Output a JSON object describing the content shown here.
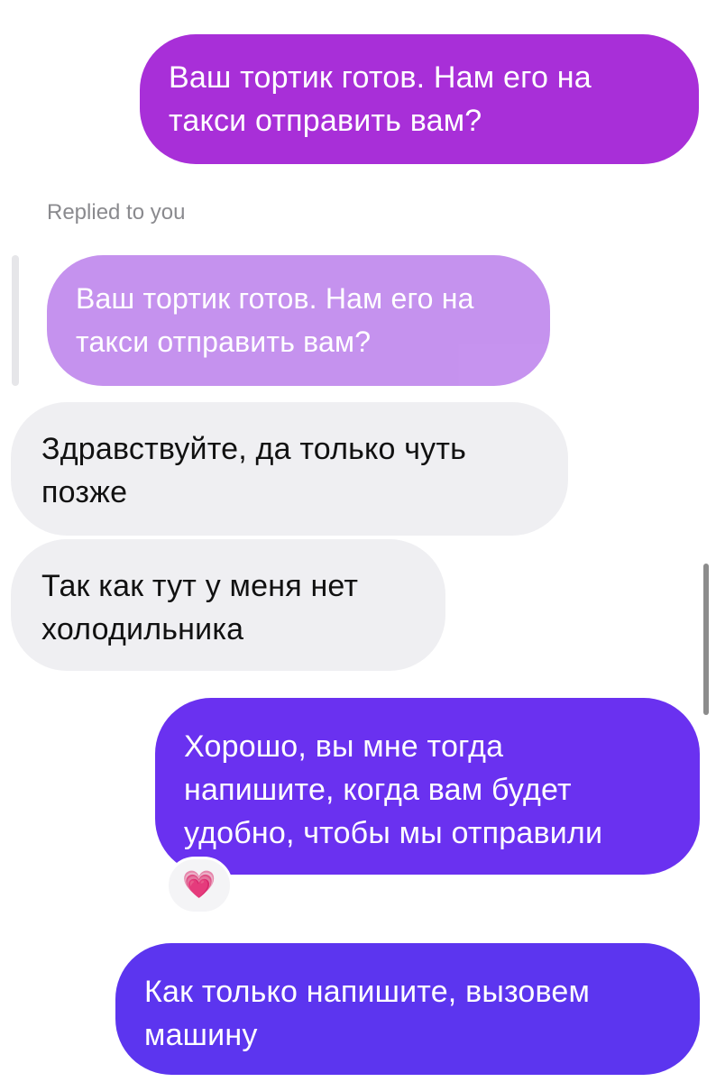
{
  "chat": {
    "messages": [
      {
        "sender": "me",
        "text": "Ваш тортик готов. Нам его на\nтакси отправить вам?"
      },
      {
        "sender": "them",
        "text": "Здравствуйте, да только чуть\nпозже"
      },
      {
        "sender": "them",
        "text": "Так как тут у меня нет\nхолодильника"
      },
      {
        "sender": "me",
        "text": "Хорошо, вы мне тогда\nнапишите, когда вам будет\nудобно, чтобы мы отправили"
      },
      {
        "sender": "me",
        "text": "Как только напишите, вызовем\nмашину"
      }
    ],
    "reply": {
      "label": "Replied to you",
      "quoted_text": "Ваш тортик готов. Нам его на\nтакси отправить вам?"
    },
    "reaction": {
      "emoji": "💗",
      "icon": "growing-heart-icon"
    }
  },
  "colors": {
    "outgoing_1": "#a82fd8",
    "outgoing_2": "#6a31f0",
    "outgoing_3": "#5c35ef",
    "incoming": "#efeff2",
    "quoted": "#c48fee"
  }
}
